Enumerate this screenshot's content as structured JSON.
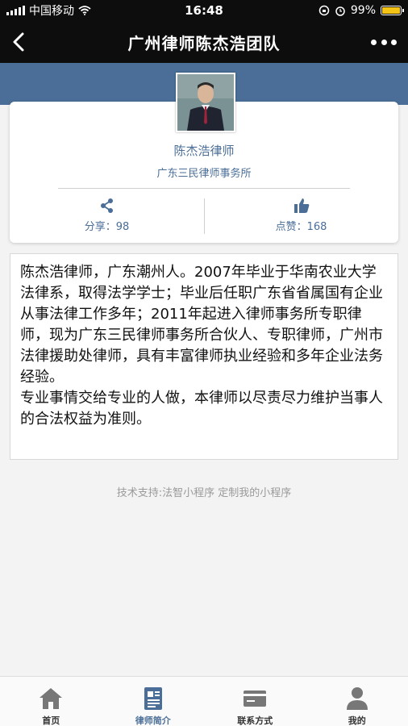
{
  "status_bar": {
    "carrier": "中国移动",
    "time": "16:48",
    "battery": "99%",
    "battery_level": 0.99
  },
  "nav": {
    "title": "广州律师陈杰浩团队",
    "back_icon": "chevron-left-icon",
    "more_icon": "more-dots-icon"
  },
  "profile": {
    "name": "陈杰浩律师",
    "firm": "广东三民律师事务所",
    "share_label": "分享：98",
    "like_label": "点赞：168",
    "accent_color": "#4a6e97"
  },
  "bio": {
    "paragraph1": "陈杰浩律师，广东潮州人。2007年毕业于华南农业大学法律系，取得法学学士；毕业后任职广东省省属国有企业从事法律工作多年；2011年起进入律师事务所专职律师，现为广东三民律师事务所合伙人、专职律师，广州市法律援助处律师，具有丰富律师执业经验和多年企业法务经验。",
    "paragraph2": "专业事情交给专业的人做，本律师以尽责尽力维护当事人的合法权益为准则。"
  },
  "footer": {
    "credit": "技术支持:法智小程序 定制我的小程序"
  },
  "tabs": [
    {
      "label": "首页",
      "icon": "home-icon",
      "active": false
    },
    {
      "label": "律师简介",
      "icon": "profile-doc-icon",
      "active": true
    },
    {
      "label": "联系方式",
      "icon": "contact-card-icon",
      "active": false
    },
    {
      "label": "我的",
      "icon": "user-icon",
      "active": false
    }
  ]
}
